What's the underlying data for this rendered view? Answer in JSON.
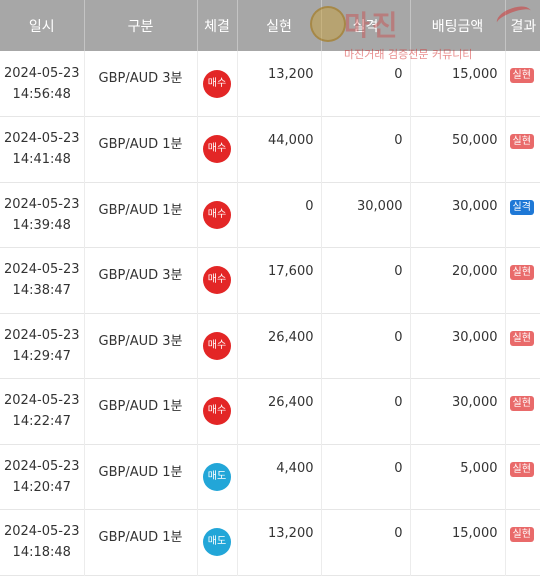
{
  "header": {
    "col_datetime": "일시",
    "col_category": "구분",
    "col_type": "체결",
    "col_realized": "실현",
    "col_loss": "실격",
    "col_bet": "배팅금액",
    "col_result": "결과"
  },
  "watermark": {
    "title": "마진",
    "subtitle": "마진거래 검증전문 커뮤니티"
  },
  "colors": {
    "buy": "#e32626",
    "sell": "#22a6d8",
    "realized_badge": "#e96a6a",
    "loss_badge": "#1e78d6",
    "header_bg": "#a7a7a7"
  },
  "rows": [
    {
      "date": "2024-05-23",
      "time": "14:56:48",
      "category": "GBP/AUD 3분",
      "type": "매수",
      "realized": "13,200",
      "loss": "0",
      "bet": "15,000",
      "result": "실현"
    },
    {
      "date": "2024-05-23",
      "time": "14:41:48",
      "category": "GBP/AUD 1분",
      "type": "매수",
      "realized": "44,000",
      "loss": "0",
      "bet": "50,000",
      "result": "실현"
    },
    {
      "date": "2024-05-23",
      "time": "14:39:48",
      "category": "GBP/AUD 1분",
      "type": "매수",
      "realized": "0",
      "loss": "30,000",
      "bet": "30,000",
      "result": "실격"
    },
    {
      "date": "2024-05-23",
      "time": "14:38:47",
      "category": "GBP/AUD 3분",
      "type": "매수",
      "realized": "17,600",
      "loss": "0",
      "bet": "20,000",
      "result": "실현"
    },
    {
      "date": "2024-05-23",
      "time": "14:29:47",
      "category": "GBP/AUD 3분",
      "type": "매수",
      "realized": "26,400",
      "loss": "0",
      "bet": "30,000",
      "result": "실현"
    },
    {
      "date": "2024-05-23",
      "time": "14:22:47",
      "category": "GBP/AUD 1분",
      "type": "매수",
      "realized": "26,400",
      "loss": "0",
      "bet": "30,000",
      "result": "실현"
    },
    {
      "date": "2024-05-23",
      "time": "14:20:47",
      "category": "GBP/AUD 1분",
      "type": "매도",
      "realized": "4,400",
      "loss": "0",
      "bet": "5,000",
      "result": "실현"
    },
    {
      "date": "2024-05-23",
      "time": "14:18:48",
      "category": "GBP/AUD 1분",
      "type": "매도",
      "realized": "13,200",
      "loss": "0",
      "bet": "15,000",
      "result": "실현"
    }
  ]
}
